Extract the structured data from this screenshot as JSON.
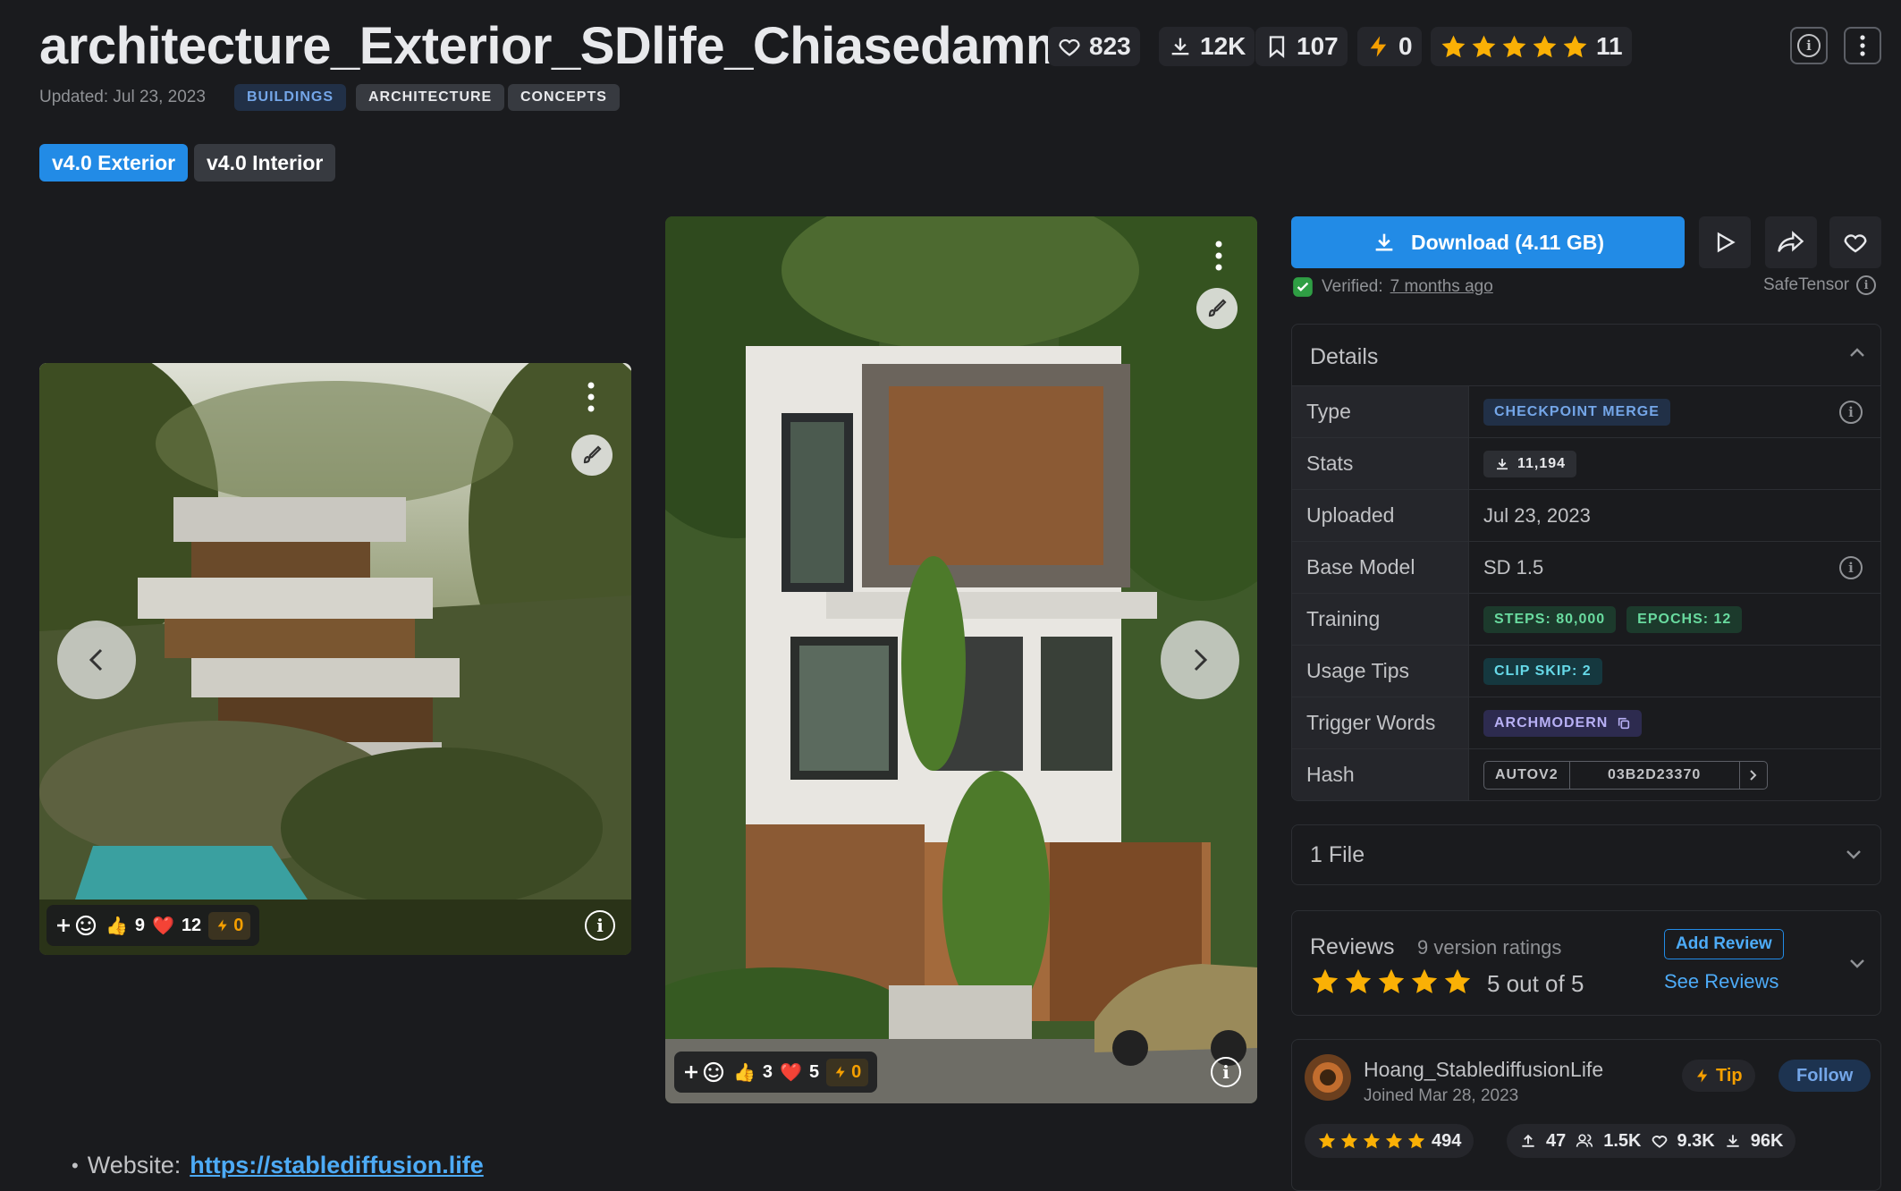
{
  "header": {
    "title": "architecture_Exterior_SDlife_Chiasedamme",
    "likes": "823",
    "downloads": "12K",
    "bookmarks": "107",
    "buzz": "0",
    "rating_count": "11",
    "updated": "Updated: Jul 23, 2023",
    "tags": [
      "BUILDINGS",
      "ARCHITECTURE",
      "CONCEPTS"
    ]
  },
  "versions": [
    "v4.0 Exterior",
    "v4.0 Interior"
  ],
  "gallery": {
    "left": {
      "likes": "9",
      "hearts": "12",
      "buzz": "0"
    },
    "right": {
      "likes": "3",
      "hearts": "5",
      "buzz": "0"
    }
  },
  "website": {
    "label": "Website:",
    "link": "https://stablediffusion.life"
  },
  "download": {
    "label": "Download (4.11 GB)",
    "verified_label": "Verified:",
    "verified_time": "7 months ago",
    "safetensor": "SafeTensor"
  },
  "details": {
    "title": "Details",
    "type_label": "Type",
    "type_value": "CHECKPOINT MERGE",
    "stats_label": "Stats",
    "stats_value": "11,194",
    "uploaded_label": "Uploaded",
    "uploaded_value": "Jul 23, 2023",
    "base_label": "Base Model",
    "base_value": "SD 1.5",
    "training_label": "Training",
    "steps": "STEPS: 80,000",
    "epochs": "EPOCHS: 12",
    "tips_label": "Usage Tips",
    "clip": "CLIP SKIP: 2",
    "trigger_label": "Trigger Words",
    "trigger": "ARCHMODERN",
    "hash_label": "Hash",
    "hash_type": "AUTOV2",
    "hash_value": "03B2D23370"
  },
  "files": {
    "label": "1 File"
  },
  "reviews": {
    "title": "Reviews",
    "count": "9 version ratings",
    "score": "5 out of 5",
    "add": "Add Review",
    "see": "See Reviews"
  },
  "creator": {
    "name": "Hoang_StablediffusionLife",
    "joined": "Joined Mar 28, 2023",
    "tip": "Tip",
    "follow": "Follow",
    "rating_count": "494",
    "uploads": "47",
    "followers": "1.5K",
    "likes": "9.3K",
    "downloads": "96K"
  },
  "colors": {
    "accent": "#228be6",
    "star": "#fab005",
    "buzz": "#f59f00",
    "bg": "#1a1b1e"
  }
}
